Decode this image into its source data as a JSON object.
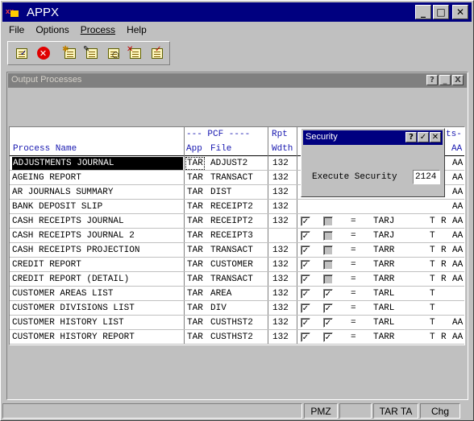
{
  "app": {
    "title": "APPX"
  },
  "menu": [
    {
      "label": "File"
    },
    {
      "label": "Options"
    },
    {
      "label": "Process"
    },
    {
      "label": "Help"
    }
  ],
  "toolbar": {
    "icons": [
      "ok-check-icon",
      "cancel-stop-icon",
      "new-star-icon",
      "open-icon",
      "find-icon",
      "delete-icon",
      "clear-icon"
    ]
  },
  "inner_window": {
    "title": "Output Processes",
    "buttons": [
      "?",
      "_",
      "X"
    ]
  },
  "grid": {
    "headers": {
      "process_name": "Process Name",
      "pcf_top": "--- PCF ----",
      "app": "App",
      "file": "File",
      "rpt_top": "Rpt",
      "rpt_bottom": "Wdth",
      "ts_top": "ts-",
      "aa_bottom": "AA"
    },
    "rows": [
      {
        "name": "ADJUSTMENTS JOURNAL",
        "app": "TAR",
        "file": "ADJUST2",
        "wdth": "132",
        "c1": null,
        "c2": null,
        "eq": "",
        "group": "",
        "t": "",
        "r": "",
        "aa": "AA",
        "selected": true
      },
      {
        "name": "AGEING REPORT",
        "app": "TAR",
        "file": "TRANSACT",
        "wdth": "132",
        "c1": null,
        "c2": null,
        "eq": "",
        "group": "",
        "t": "",
        "r": "",
        "aa": "AA"
      },
      {
        "name": "AR JOURNALS SUMMARY",
        "app": "TAR",
        "file": "DIST",
        "wdth": "132",
        "c1": null,
        "c2": null,
        "eq": "",
        "group": "",
        "t": "",
        "r": "",
        "aa": "AA"
      },
      {
        "name": "BANK DEPOSIT SLIP",
        "app": "TAR",
        "file": "RECEIPT2",
        "wdth": "132",
        "c1": null,
        "c2": null,
        "eq": "",
        "group": "",
        "t": "",
        "r": "",
        "aa": "AA"
      },
      {
        "name": "CASH RECEIPTS JOURNAL",
        "app": "TAR",
        "file": "RECEIPT2",
        "wdth": "132",
        "c1": true,
        "c2": false,
        "eq": "=",
        "group": "TARJ",
        "t": "T",
        "r": "R",
        "aa": "AA"
      },
      {
        "name": "CASH RECEIPTS JOURNAL 2",
        "app": "TAR",
        "file": "RECEIPT3",
        "wdth": "",
        "c1": true,
        "c2": false,
        "eq": "=",
        "group": "TARJ",
        "t": "T",
        "r": "",
        "aa": "AA"
      },
      {
        "name": "CASH RECEIPTS PROJECTION",
        "app": "TAR",
        "file": "TRANSACT",
        "wdth": "132",
        "c1": true,
        "c2": false,
        "eq": "=",
        "group": "TARR",
        "t": "T",
        "r": "R",
        "aa": "AA"
      },
      {
        "name": "CREDIT REPORT",
        "app": "TAR",
        "file": "CUSTOMER",
        "wdth": "132",
        "c1": true,
        "c2": false,
        "eq": "=",
        "group": "TARR",
        "t": "T",
        "r": "R",
        "aa": "AA"
      },
      {
        "name": "CREDIT REPORT (DETAIL)",
        "app": "TAR",
        "file": "TRANSACT",
        "wdth": "132",
        "c1": true,
        "c2": false,
        "eq": "=",
        "group": "TARR",
        "t": "T",
        "r": "R",
        "aa": "AA"
      },
      {
        "name": "CUSTOMER AREAS LIST",
        "app": "TAR",
        "file": "AREA",
        "wdth": "132",
        "c1": true,
        "c2": true,
        "eq": "=",
        "group": "TARL",
        "t": "T",
        "r": "",
        "aa": ""
      },
      {
        "name": "CUSTOMER DIVISIONS LIST",
        "app": "TAR",
        "file": "DIV",
        "wdth": "132",
        "c1": true,
        "c2": true,
        "eq": "=",
        "group": "TARL",
        "t": "T",
        "r": "",
        "aa": ""
      },
      {
        "name": "CUSTOMER HISTORY LIST",
        "app": "TAR",
        "file": "CUSTHST2",
        "wdth": "132",
        "c1": true,
        "c2": true,
        "eq": "=",
        "group": "TARL",
        "t": "T",
        "r": "",
        "aa": "AA"
      },
      {
        "name": "CUSTOMER HISTORY REPORT",
        "app": "TAR",
        "file": "CUSTHST2",
        "wdth": "132",
        "c1": true,
        "c2": true,
        "eq": "=",
        "group": "TARR",
        "t": "T",
        "r": "R",
        "aa": "AA"
      }
    ]
  },
  "security_dialog": {
    "title": "Security",
    "label": "Execute Security",
    "value": "2124"
  },
  "status": {
    "panels": [
      "PMZ",
      "TAR TA",
      "Chg"
    ]
  }
}
